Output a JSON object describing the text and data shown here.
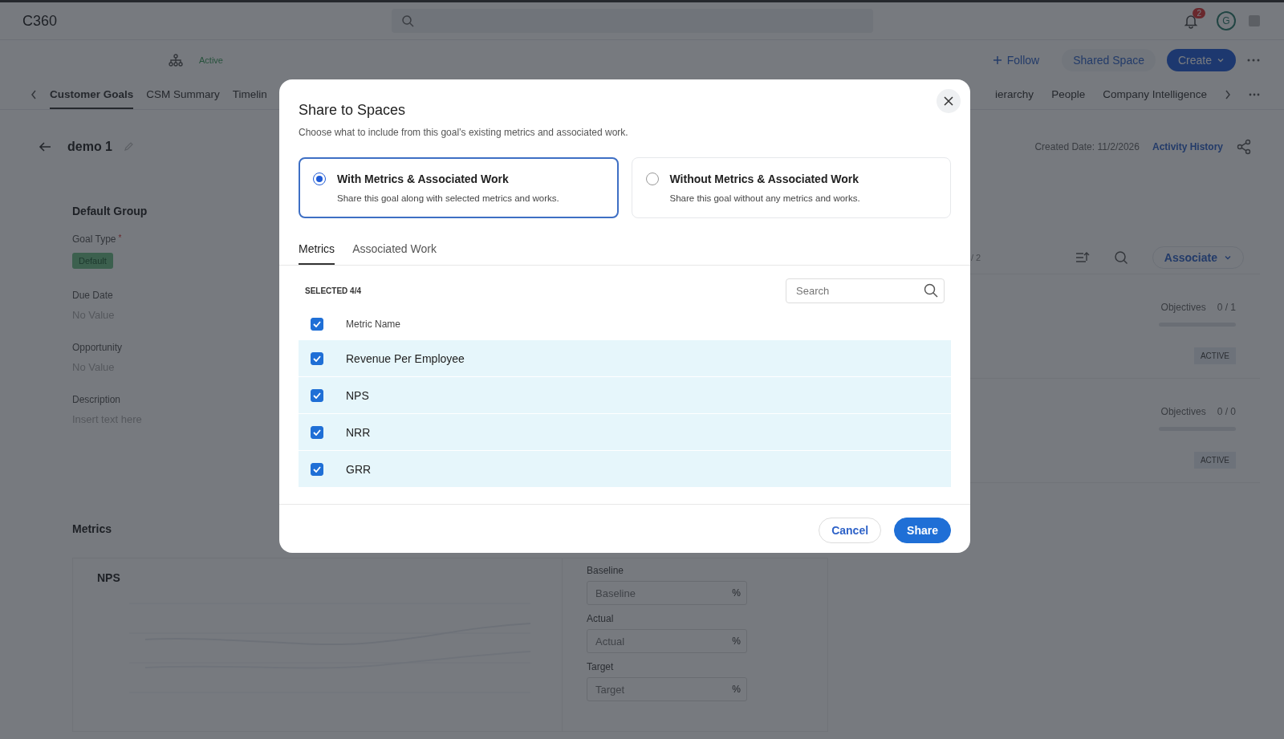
{
  "header": {
    "app_name": "C360",
    "notification_count": "2",
    "avatar_letter": "G"
  },
  "account_bar": {
    "status": "Active",
    "actions": [
      {
        "label": "Follow",
        "kind": "follow"
      },
      {
        "label": "Shared Space",
        "kind": "plain"
      },
      {
        "label": "Create",
        "kind": "primary"
      }
    ]
  },
  "tabs": [
    {
      "label": "Customer Goals",
      "selected": true
    },
    {
      "label": "CSM Summary",
      "selected": false
    },
    {
      "label": "Timelin",
      "selected": false
    }
  ],
  "tabs_right": [
    {
      "label": "ierarchy",
      "selected": false
    },
    {
      "label": "People",
      "selected": false
    },
    {
      "label": "Company Intelligence",
      "selected": false
    }
  ],
  "goal": {
    "title": "demo 1",
    "created_date": "Created Date: 11/2/2026",
    "activity_link": "Activity History"
  },
  "details": {
    "group_title": "Default Group",
    "fields": [
      {
        "label": "Goal Type",
        "required_mark": "*",
        "kind": "tag",
        "value": "Default"
      },
      {
        "label": "Due Date",
        "kind": "empty",
        "value": "No Value"
      },
      {
        "label": "Opportunity",
        "kind": "empty",
        "value": "No Value"
      },
      {
        "label": "Description",
        "kind": "empty",
        "value": "Insert text here"
      }
    ]
  },
  "metrics": {
    "title": "Metrics",
    "card_title": "NPS",
    "inputs": [
      {
        "label": "Baseline",
        "placeholder": "Baseline",
        "unit": "%"
      },
      {
        "label": "Actual",
        "placeholder": "Actual",
        "unit": "%"
      },
      {
        "label": "Target",
        "placeholder": "Target",
        "unit": "%"
      }
    ]
  },
  "associated": {
    "count": "/ 2",
    "button": "Associate",
    "items": [
      {
        "label": "Objectives",
        "count": "0 / 1",
        "level": 0,
        "status": "ACTIVE"
      },
      {
        "label": "Objectives",
        "count": "0 / 0",
        "level": 0,
        "status": "ACTIVE"
      }
    ]
  },
  "dialog": {
    "title": "Share to Spaces",
    "subtitle": "Choose what to include from this goal’s existing metrics and associated work.",
    "options": [
      {
        "title": "With Metrics & Associated Work",
        "description": "Share this goal along with selected metrics and works.",
        "selected": true
      },
      {
        "title": "Without Metrics & Associated Work",
        "description": "Share this goal without any metrics and works.",
        "selected": false
      }
    ],
    "tabs": [
      {
        "label": "Metrics",
        "selected": true
      },
      {
        "label": "Associated Work",
        "selected": false
      }
    ],
    "selected_count": "SELECTED 4/4",
    "search": {
      "placeholder": "Search"
    },
    "column": "Metric Name",
    "all_checked": true,
    "rows": [
      {
        "name": "Revenue Per Employee",
        "checked": true
      },
      {
        "name": "NPS",
        "checked": true
      },
      {
        "name": "NRR",
        "checked": true
      },
      {
        "name": "GRR",
        "checked": true
      }
    ],
    "buttons": [
      {
        "label": "Cancel",
        "kind": "secondary"
      },
      {
        "label": "Share",
        "kind": "primary"
      }
    ]
  }
}
